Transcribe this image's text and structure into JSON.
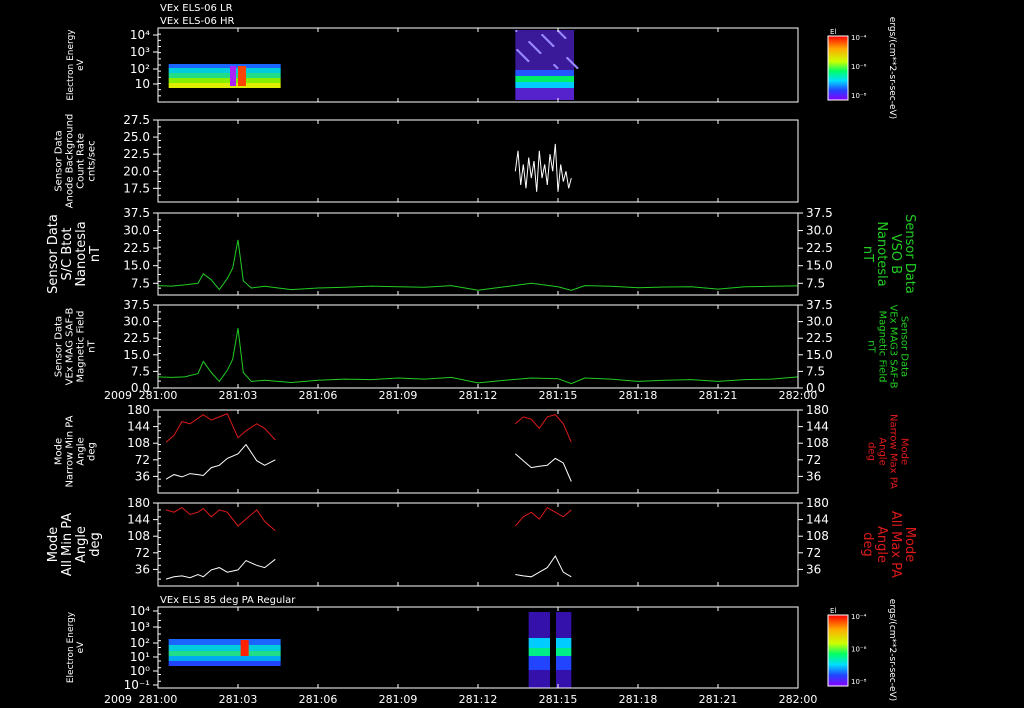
{
  "colors": {
    "background": "#000000",
    "axis": "#ffffff",
    "electron_min": "#ffffff",
    "b_field": "#22cc22",
    "max_pa": "#dd1a1a"
  },
  "header": {
    "line1": "VEx ELS-06 LR",
    "line2": "VEx ELS-06 HR"
  },
  "panels": [
    {
      "id": "spec1",
      "type": "heatmap",
      "ylabel_left": [
        "Electron Energy",
        "eV"
      ],
      "ylabel_right": [],
      "yticks": [
        "10",
        "10²",
        "10³",
        "10⁴"
      ],
      "colorbar": {
        "label": "El",
        "ticks": [
          "10⁻⁴",
          "10⁻⁶",
          "10⁻⁸"
        ],
        "unit": "ergs/(cm**2-sr-sec-eV)"
      }
    },
    {
      "id": "anode",
      "type": "line",
      "ylabel_left": [
        "Sensor Data",
        "Anode Background",
        "Count Rate",
        "cnts/sec"
      ],
      "ylabel_right": [],
      "yticks": [
        "17.5",
        "20.0",
        "22.5",
        "25.0",
        "27.5"
      ],
      "ylim": [
        15.5,
        27.5
      ]
    },
    {
      "id": "bt",
      "type": "line",
      "ylabel_left": [
        "Sensor Data",
        "S/C Btot",
        "Nanotesla",
        "nT"
      ],
      "ylabel_right": [
        "Sensor Data",
        "VSO B",
        "Nanotesla",
        "nT"
      ],
      "yticks": [
        "7.5",
        "15.0",
        "22.5",
        "30.0",
        "37.5"
      ],
      "ylim": [
        2.5,
        37.5
      ]
    },
    {
      "id": "mag",
      "type": "line",
      "ylabel_left": [
        "Sensor Data",
        "VEx MAG SAF-B",
        "Magnetic Field",
        "nT"
      ],
      "ylabel_right": [
        "Sensor Data",
        "VEx MAG3 SAF-B",
        "Magnetic Field",
        "nT"
      ],
      "yticks": [
        "0.0",
        "7.5",
        "15.0",
        "22.5",
        "30.0",
        "37.5"
      ],
      "ylim": [
        0,
        37.5
      ]
    },
    {
      "id": "narrow",
      "type": "line",
      "ylabel_left": [
        "Mode",
        "Narrow Min PA",
        "Angle",
        "deg"
      ],
      "ylabel_right": [
        "Mode",
        "Narrow Max PA",
        "Angle",
        "deg"
      ],
      "yticks": [
        "36",
        "72",
        "108",
        "144",
        "180"
      ],
      "ylim": [
        0,
        180
      ]
    },
    {
      "id": "allpa",
      "type": "line",
      "ylabel_left": [
        "Mode",
        "All Min PA",
        "Angle",
        "deg"
      ],
      "ylabel_right": [
        "Mode",
        "All Max PA",
        "Angle",
        "deg"
      ],
      "yticks": [
        "36",
        "72",
        "108",
        "144",
        "180"
      ],
      "ylim": [
        0,
        180
      ]
    },
    {
      "id": "spec2",
      "type": "heatmap",
      "title": "VEx ELS 85 deg PA Regular",
      "ylabel_left": [
        "Electron Energy",
        "eV"
      ],
      "ylabel_right": [],
      "yticks": [
        "10⁻¹",
        "10⁰",
        "10¹",
        "10²",
        "10³",
        "10⁴"
      ],
      "colorbar": {
        "label": "El",
        "ticks": [
          "10⁻⁴",
          "10⁻⁶",
          "10⁻⁸"
        ],
        "unit": "ergs/(cm**2-sr-sec-eV)"
      }
    }
  ],
  "xaxis": {
    "year": "2009",
    "ticks": [
      "281:00",
      "281:03",
      "281:06",
      "281:09",
      "281:12",
      "281:15",
      "281:18",
      "281:21",
      "282:00"
    ]
  },
  "chart_data": {
    "type": "line",
    "x_unit": "DOY:hour",
    "x_range": [
      "281:00",
      "282:00"
    ],
    "series": [
      {
        "name": "S/C Btot (nT)",
        "x_hours": [
          0,
          0.5,
          1,
          1.5,
          1.7,
          2,
          2.3,
          2.6,
          2.8,
          3,
          3.2,
          3.5,
          4,
          5,
          6,
          7,
          8,
          9,
          10,
          11,
          12,
          13,
          14,
          15,
          15.5,
          16,
          17,
          18,
          19,
          20,
          21,
          22,
          23,
          24
        ],
        "values": [
          6.5,
          6.3,
          6.8,
          7.5,
          11.5,
          9,
          4.8,
          9.5,
          14,
          26,
          8.5,
          5.5,
          6.2,
          4.8,
          5.5,
          5.8,
          6.3,
          6,
          5.8,
          6.5,
          4.5,
          6,
          7.5,
          6,
          4.5,
          6.5,
          6.2,
          5.6,
          5.9,
          6,
          5,
          6,
          6.2,
          6.4
        ]
      },
      {
        "name": "MAG SAF-B (nT)",
        "x_hours": [
          0,
          0.5,
          1,
          1.5,
          1.7,
          2,
          2.3,
          2.6,
          2.8,
          3,
          3.2,
          3.5,
          4,
          5,
          6,
          7,
          8,
          9,
          10,
          11,
          12,
          13,
          14,
          15,
          15.5,
          16,
          17,
          18,
          19,
          20,
          21,
          22,
          23,
          24
        ],
        "values": [
          5,
          4.8,
          5,
          6.5,
          12,
          7,
          3,
          8,
          13,
          27,
          7,
          3,
          3.5,
          2.5,
          3.5,
          4,
          3.8,
          4.5,
          4,
          4.8,
          2.3,
          3.5,
          4.5,
          4.2,
          2,
          4.5,
          4,
          3,
          3.5,
          3.8,
          3,
          3.8,
          4,
          5
        ]
      },
      {
        "name": "Narrow Min PA (deg)",
        "x_hours": [
          0.3,
          0.6,
          0.9,
          1.2,
          1.5,
          1.7,
          2,
          2.3,
          2.6,
          3,
          3.3,
          3.7,
          4,
          4.4,
          13.4,
          13.7,
          14,
          14.3,
          14.6,
          14.9,
          15.2,
          15.5
        ],
        "values": [
          30,
          40,
          35,
          42,
          40,
          38,
          55,
          60,
          75,
          85,
          105,
          70,
          60,
          72,
          85,
          70,
          55,
          58,
          60,
          75,
          65,
          25
        ]
      },
      {
        "name": "Narrow Max PA (deg)",
        "x_hours": [
          0.3,
          0.6,
          0.9,
          1.2,
          1.5,
          1.7,
          2,
          2.3,
          2.6,
          3,
          3.3,
          3.7,
          4,
          4.4,
          13.4,
          13.7,
          14,
          14.3,
          14.6,
          14.9,
          15.2,
          15.5
        ],
        "values": [
          110,
          125,
          155,
          150,
          162,
          170,
          158,
          165,
          172,
          120,
          135,
          150,
          140,
          115,
          150,
          165,
          160,
          140,
          165,
          170,
          150,
          110
        ]
      },
      {
        "name": "All Min PA (deg)",
        "x_hours": [
          0.3,
          0.6,
          0.9,
          1.2,
          1.5,
          1.7,
          2,
          2.3,
          2.6,
          3,
          3.3,
          3.7,
          4,
          4.4,
          13.4,
          13.7,
          14,
          14.3,
          14.6,
          14.9,
          15.2,
          15.5
        ],
        "values": [
          15,
          20,
          22,
          18,
          25,
          20,
          35,
          40,
          30,
          35,
          55,
          45,
          40,
          58,
          25,
          22,
          20,
          30,
          40,
          65,
          30,
          20
        ]
      },
      {
        "name": "All Max PA (deg)",
        "x_hours": [
          0.3,
          0.6,
          0.9,
          1.2,
          1.5,
          1.7,
          2,
          2.3,
          2.6,
          3,
          3.3,
          3.7,
          4,
          4.4,
          13.4,
          13.7,
          14,
          14.3,
          14.6,
          14.9,
          15.2,
          15.5
        ],
        "values": [
          165,
          160,
          170,
          155,
          160,
          168,
          150,
          165,
          160,
          130,
          145,
          165,
          140,
          120,
          130,
          150,
          160,
          145,
          170,
          160,
          150,
          165
        ]
      },
      {
        "name": "Anode Background (cnts/sec)",
        "x_hours": [
          13.4,
          13.5,
          13.6,
          13.7,
          13.8,
          13.9,
          14,
          14.1,
          14.2,
          14.3,
          14.4,
          14.5,
          14.6,
          14.7,
          14.8,
          14.9,
          15,
          15.1,
          15.2,
          15.3,
          15.4,
          15.5
        ],
        "values": [
          20,
          23,
          18,
          21,
          17.5,
          22,
          19,
          21.5,
          17,
          23,
          19,
          21,
          18,
          22.5,
          20,
          24,
          17,
          21,
          18.5,
          20,
          17.5,
          19
        ]
      }
    ]
  }
}
